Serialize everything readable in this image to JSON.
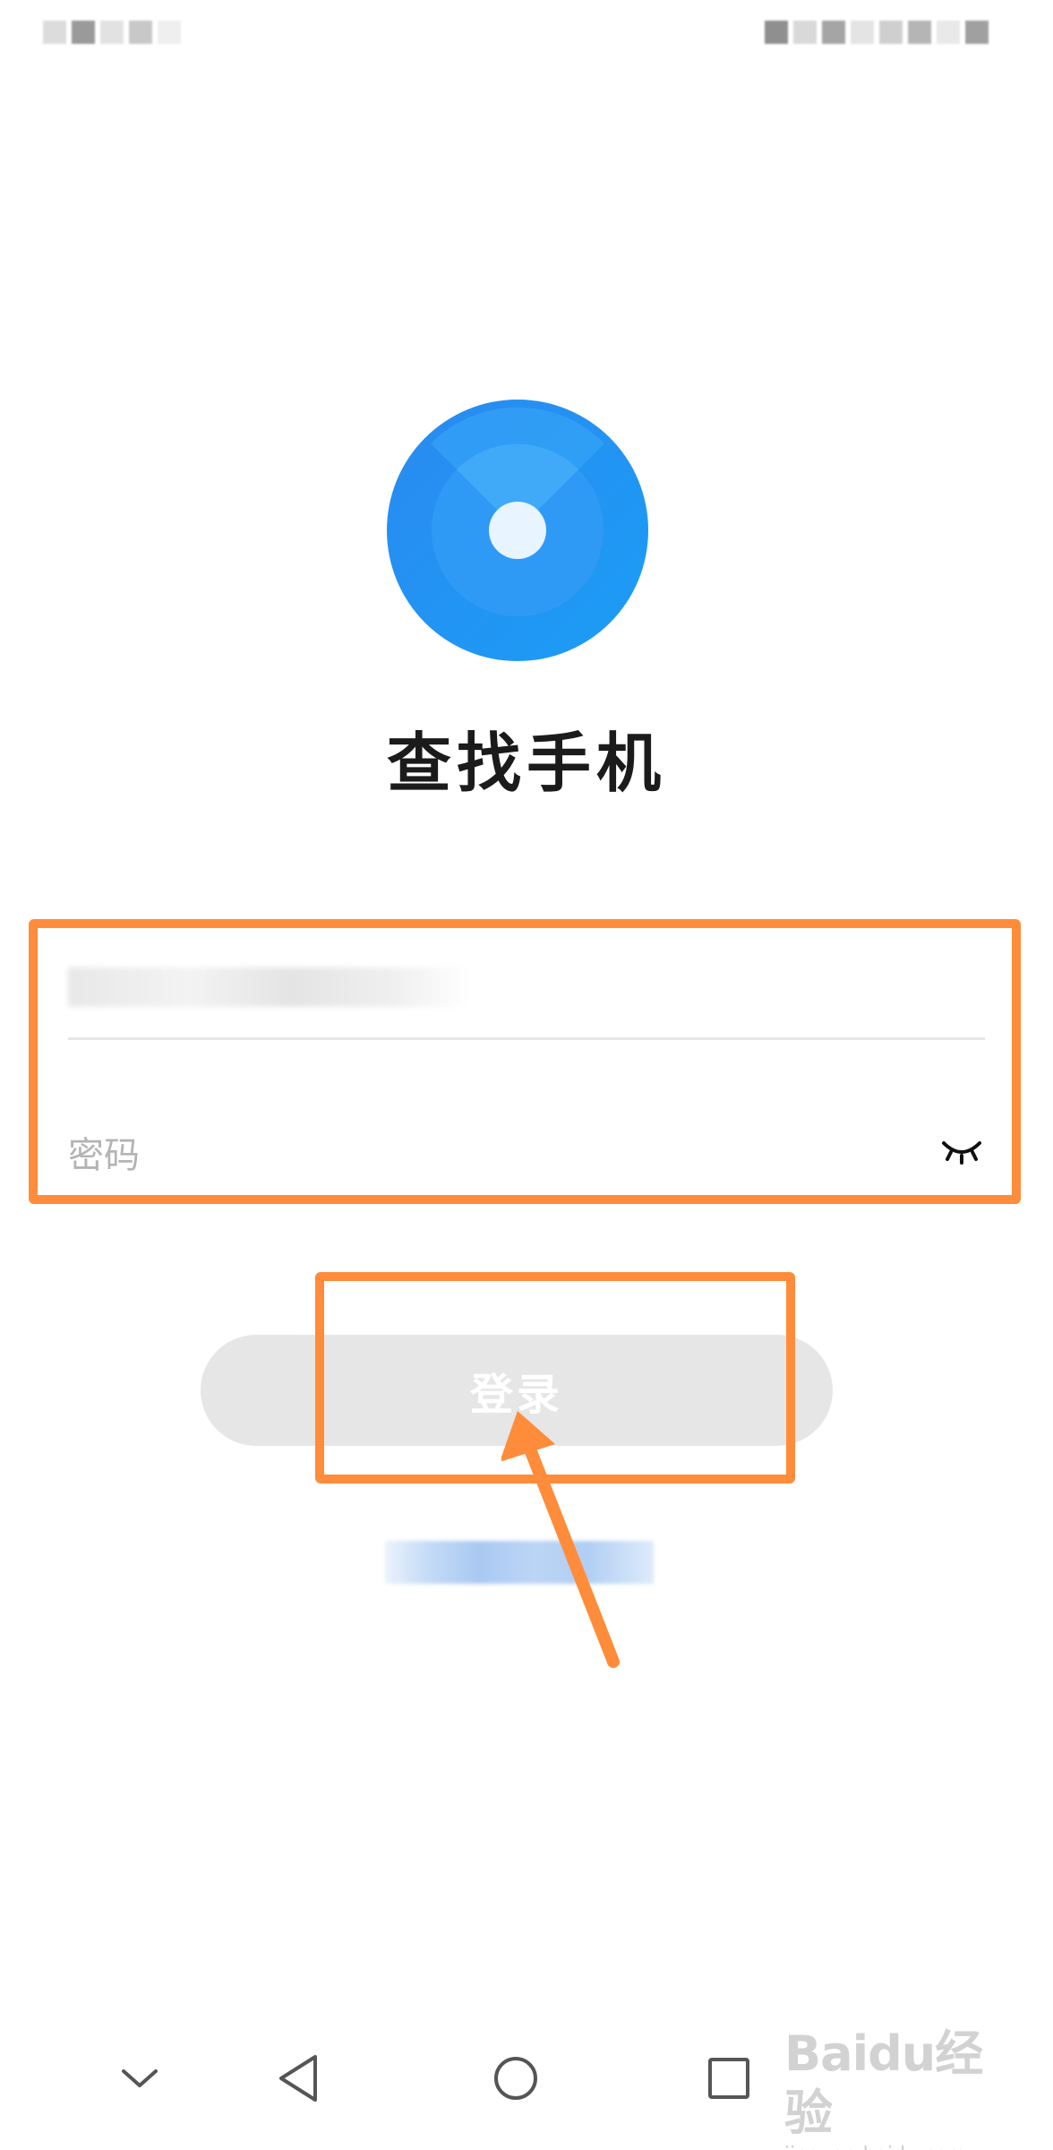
{
  "app": {
    "title": "查找手机",
    "brand_color": "#1a8cf5"
  },
  "form": {
    "account_value": "",
    "password_placeholder": "密码",
    "login_label": "登录",
    "register_link": "",
    "eye_icon": "eye-closed-icon"
  },
  "annotations": {
    "highlight_color": "#ff8c3a"
  },
  "nav_bar": {
    "buttons": [
      "chevron-down-icon",
      "back-triangle-icon",
      "home-circle-icon",
      "recents-square-icon"
    ]
  },
  "watermark": {
    "logo": "Baidu经验",
    "url": "jingyan.baidu.com"
  }
}
